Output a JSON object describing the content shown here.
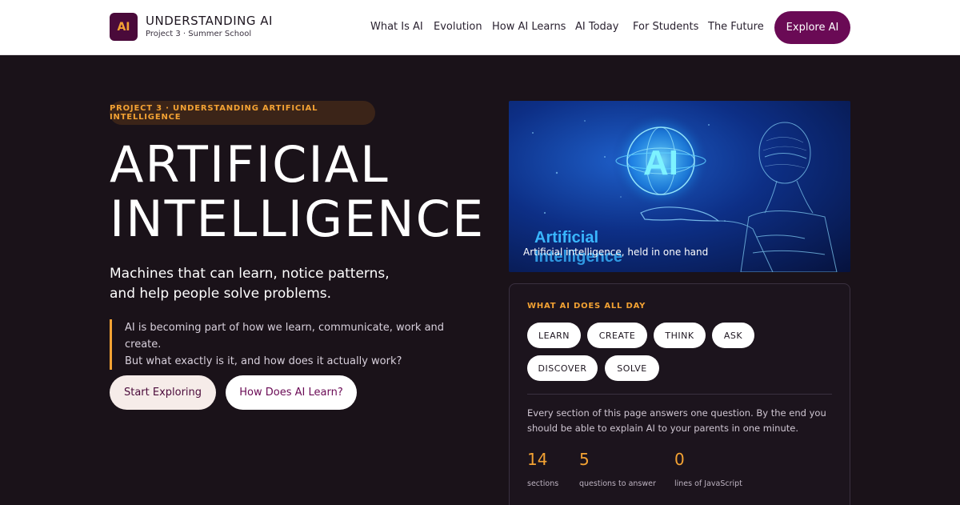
{
  "header": {
    "logo_text": "AI",
    "brand_title": "UNDERSTANDING AI",
    "brand_subtitle": "Project 3 · Summer School",
    "nav": [
      "What Is AI",
      "Evolution",
      "How AI Learns",
      "AI Today",
      "For Students",
      "The Future"
    ],
    "cta_label": "Explore AI"
  },
  "hero": {
    "eyebrow": "PROJECT 3 · UNDERSTANDING ARTIFICIAL INTELLIGENCE",
    "title_line1": "ARTIFICIAL",
    "title_line2": "INTELLIGENCE",
    "lead_line1": "Machines that can learn, notice patterns,",
    "lead_line2": "and help people solve problems.",
    "quote_line1": "AI is becoming part of how we learn, communicate, work and create.",
    "quote_line2": "But what exactly is it, and how does it actually work?",
    "primary_button": "Start Exploring",
    "secondary_button": "How Does AI Learn?"
  },
  "image": {
    "caption": "Artificial intelligence, held in one hand",
    "globe_text": "AI",
    "overlay_line1": "Artificial",
    "overlay_line2": "Intelligence"
  },
  "card": {
    "label": "WHAT AI DOES ALL DAY",
    "chips": [
      "LEARN",
      "CREATE",
      "THINK",
      "ASK",
      "DISCOVER",
      "SOLVE"
    ],
    "description": "Every section of this page answers one question. By the end you should be able to explain AI to your parents in one minute.",
    "stats": [
      {
        "value": "14",
        "label": "sections"
      },
      {
        "value": "5",
        "label": "questions to answer"
      },
      {
        "value": "0",
        "label": "lines of JavaScript"
      }
    ]
  },
  "colors": {
    "accent": "#f3a233",
    "brand": "#6a0a55",
    "background": "#1a1219"
  }
}
